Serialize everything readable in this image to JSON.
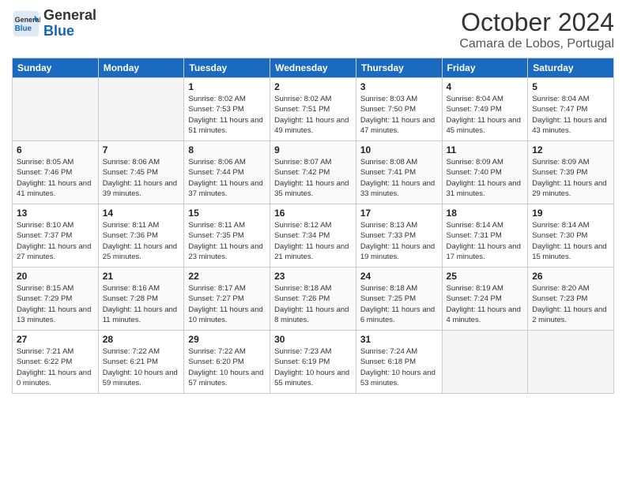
{
  "header": {
    "logo": {
      "general": "General",
      "blue": "Blue"
    },
    "month": "October 2024",
    "location": "Camara de Lobos, Portugal"
  },
  "weekdays": [
    "Sunday",
    "Monday",
    "Tuesday",
    "Wednesday",
    "Thursday",
    "Friday",
    "Saturday"
  ],
  "weeks": [
    [
      {
        "day": "",
        "empty": true
      },
      {
        "day": "",
        "empty": true
      },
      {
        "day": "1",
        "sunrise": "8:02 AM",
        "sunset": "7:53 PM",
        "daylight": "11 hours and 51 minutes."
      },
      {
        "day": "2",
        "sunrise": "8:02 AM",
        "sunset": "7:51 PM",
        "daylight": "11 hours and 49 minutes."
      },
      {
        "day": "3",
        "sunrise": "8:03 AM",
        "sunset": "7:50 PM",
        "daylight": "11 hours and 47 minutes."
      },
      {
        "day": "4",
        "sunrise": "8:04 AM",
        "sunset": "7:49 PM",
        "daylight": "11 hours and 45 minutes."
      },
      {
        "day": "5",
        "sunrise": "8:04 AM",
        "sunset": "7:47 PM",
        "daylight": "11 hours and 43 minutes."
      }
    ],
    [
      {
        "day": "6",
        "sunrise": "8:05 AM",
        "sunset": "7:46 PM",
        "daylight": "11 hours and 41 minutes."
      },
      {
        "day": "7",
        "sunrise": "8:06 AM",
        "sunset": "7:45 PM",
        "daylight": "11 hours and 39 minutes."
      },
      {
        "day": "8",
        "sunrise": "8:06 AM",
        "sunset": "7:44 PM",
        "daylight": "11 hours and 37 minutes."
      },
      {
        "day": "9",
        "sunrise": "8:07 AM",
        "sunset": "7:42 PM",
        "daylight": "11 hours and 35 minutes."
      },
      {
        "day": "10",
        "sunrise": "8:08 AM",
        "sunset": "7:41 PM",
        "daylight": "11 hours and 33 minutes."
      },
      {
        "day": "11",
        "sunrise": "8:09 AM",
        "sunset": "7:40 PM",
        "daylight": "11 hours and 31 minutes."
      },
      {
        "day": "12",
        "sunrise": "8:09 AM",
        "sunset": "7:39 PM",
        "daylight": "11 hours and 29 minutes."
      }
    ],
    [
      {
        "day": "13",
        "sunrise": "8:10 AM",
        "sunset": "7:37 PM",
        "daylight": "11 hours and 27 minutes."
      },
      {
        "day": "14",
        "sunrise": "8:11 AM",
        "sunset": "7:36 PM",
        "daylight": "11 hours and 25 minutes."
      },
      {
        "day": "15",
        "sunrise": "8:11 AM",
        "sunset": "7:35 PM",
        "daylight": "11 hours and 23 minutes."
      },
      {
        "day": "16",
        "sunrise": "8:12 AM",
        "sunset": "7:34 PM",
        "daylight": "11 hours and 21 minutes."
      },
      {
        "day": "17",
        "sunrise": "8:13 AM",
        "sunset": "7:33 PM",
        "daylight": "11 hours and 19 minutes."
      },
      {
        "day": "18",
        "sunrise": "8:14 AM",
        "sunset": "7:31 PM",
        "daylight": "11 hours and 17 minutes."
      },
      {
        "day": "19",
        "sunrise": "8:14 AM",
        "sunset": "7:30 PM",
        "daylight": "11 hours and 15 minutes."
      }
    ],
    [
      {
        "day": "20",
        "sunrise": "8:15 AM",
        "sunset": "7:29 PM",
        "daylight": "11 hours and 13 minutes."
      },
      {
        "day": "21",
        "sunrise": "8:16 AM",
        "sunset": "7:28 PM",
        "daylight": "11 hours and 11 minutes."
      },
      {
        "day": "22",
        "sunrise": "8:17 AM",
        "sunset": "7:27 PM",
        "daylight": "11 hours and 10 minutes."
      },
      {
        "day": "23",
        "sunrise": "8:18 AM",
        "sunset": "7:26 PM",
        "daylight": "11 hours and 8 minutes."
      },
      {
        "day": "24",
        "sunrise": "8:18 AM",
        "sunset": "7:25 PM",
        "daylight": "11 hours and 6 minutes."
      },
      {
        "day": "25",
        "sunrise": "8:19 AM",
        "sunset": "7:24 PM",
        "daylight": "11 hours and 4 minutes."
      },
      {
        "day": "26",
        "sunrise": "8:20 AM",
        "sunset": "7:23 PM",
        "daylight": "11 hours and 2 minutes."
      }
    ],
    [
      {
        "day": "27",
        "sunrise": "7:21 AM",
        "sunset": "6:22 PM",
        "daylight": "11 hours and 0 minutes."
      },
      {
        "day": "28",
        "sunrise": "7:22 AM",
        "sunset": "6:21 PM",
        "daylight": "10 hours and 59 minutes."
      },
      {
        "day": "29",
        "sunrise": "7:22 AM",
        "sunset": "6:20 PM",
        "daylight": "10 hours and 57 minutes."
      },
      {
        "day": "30",
        "sunrise": "7:23 AM",
        "sunset": "6:19 PM",
        "daylight": "10 hours and 55 minutes."
      },
      {
        "day": "31",
        "sunrise": "7:24 AM",
        "sunset": "6:18 PM",
        "daylight": "10 hours and 53 minutes."
      },
      {
        "day": "",
        "empty": true
      },
      {
        "day": "",
        "empty": true
      }
    ]
  ]
}
